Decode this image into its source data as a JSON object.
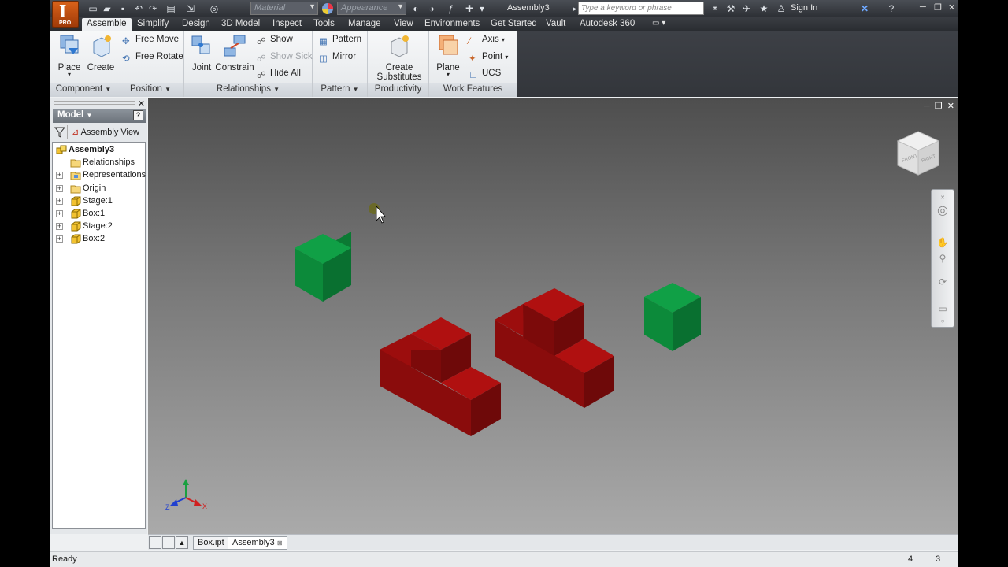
{
  "titlebar": {
    "app_badge": "PRO",
    "material_placeholder": "Material",
    "appearance_placeholder": "Appearance",
    "document_title": "Assembly3",
    "search_placeholder": "Type a keyword or phrase",
    "sign_in": "Sign In"
  },
  "ribbon_tabs": [
    "Assemble",
    "Simplify",
    "Design",
    "3D Model",
    "Inspect",
    "Tools",
    "Manage",
    "View",
    "Environments",
    "Get Started",
    "Vault",
    "Autodesk 360"
  ],
  "ribbon": {
    "component": {
      "title": "Component",
      "place": "Place",
      "create": "Create"
    },
    "position": {
      "title": "Position",
      "free_move": "Free Move",
      "free_rotate": "Free Rotate"
    },
    "relationships": {
      "title": "Relationships",
      "joint": "Joint",
      "constrain": "Constrain",
      "show": "Show",
      "show_sick": "Show Sick",
      "hide_all": "Hide All"
    },
    "pattern": {
      "title": "Pattern",
      "pattern": "Pattern",
      "mirror": "Mirror"
    },
    "productivity": {
      "title": "Productivity",
      "create_line1": "Create",
      "create_line2": "Substitutes"
    },
    "work_features": {
      "title": "Work Features",
      "plane": "Plane",
      "axis": "Axis",
      "point": "Point",
      "ucs": "UCS"
    }
  },
  "browser": {
    "header": "Model",
    "help": "?",
    "view_label": "Assembly View",
    "tree": [
      {
        "label": "Assembly3",
        "icon": "assembly-icon",
        "expand": ""
      },
      {
        "label": "Relationships",
        "icon": "folder-icon",
        "expand": ""
      },
      {
        "label": "Representations",
        "icon": "representations-icon",
        "expand": "+"
      },
      {
        "label": "Origin",
        "icon": "folder-icon",
        "expand": "+"
      },
      {
        "label": "Stage:1",
        "icon": "part-icon",
        "expand": "+"
      },
      {
        "label": "Box:1",
        "icon": "part-icon",
        "expand": "+"
      },
      {
        "label": "Stage:2",
        "icon": "part-icon",
        "expand": "+"
      },
      {
        "label": "Box:2",
        "icon": "part-icon",
        "expand": "+"
      }
    ]
  },
  "viewport": {
    "viewcube_faces": [
      "FRONT",
      "RIGHT"
    ],
    "triad": {
      "x": "X",
      "y": "Y",
      "z": "Z"
    },
    "colors": {
      "box": "#0d8f3c",
      "stage": "#a80d0d"
    }
  },
  "doc_tabs": [
    "Box.ipt",
    "Assembly3"
  ],
  "status": {
    "text": "Ready",
    "count_a": "4",
    "count_b": "3"
  }
}
